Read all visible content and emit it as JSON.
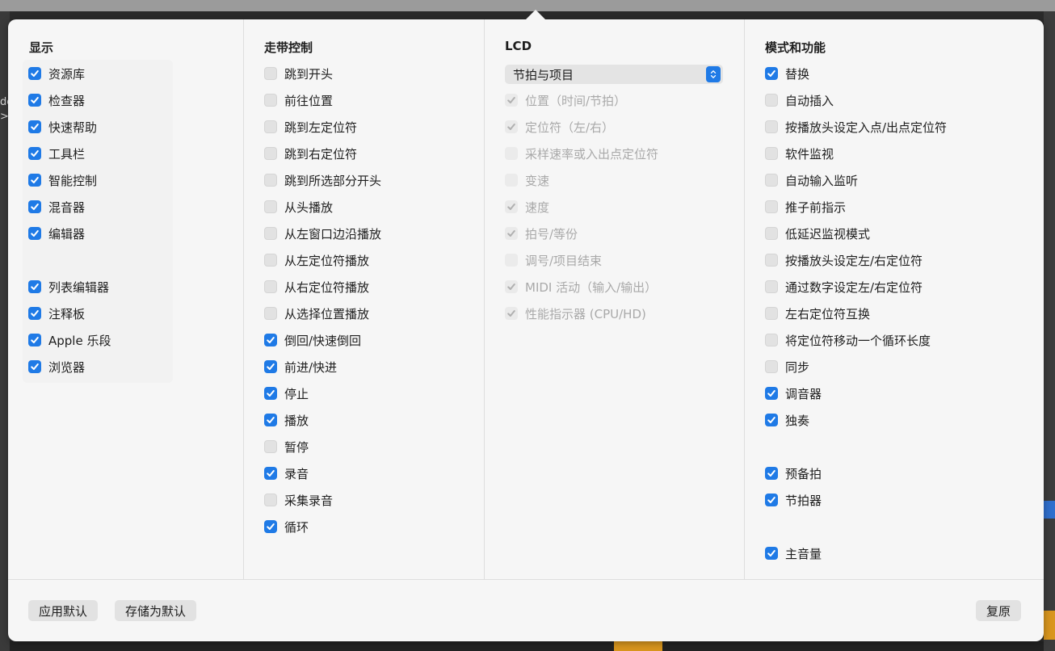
{
  "background": {
    "left_text": "de\n>"
  },
  "sections": {
    "display": {
      "title": "显示",
      "items": [
        {
          "label": "资源库",
          "checked": true
        },
        {
          "label": "检查器",
          "checked": true
        },
        {
          "label": "快速帮助",
          "checked": true
        },
        {
          "label": "工具栏",
          "checked": true
        },
        {
          "label": "智能控制",
          "checked": true
        },
        {
          "label": "混音器",
          "checked": true
        },
        {
          "label": "编辑器",
          "checked": true
        },
        {
          "label": "列表编辑器",
          "checked": true
        },
        {
          "label": "注释板",
          "checked": true
        },
        {
          "label": "Apple 乐段",
          "checked": true
        },
        {
          "label": "浏览器",
          "checked": true
        }
      ]
    },
    "transport": {
      "title": "走带控制",
      "items": [
        {
          "label": "跳到开头",
          "checked": false
        },
        {
          "label": "前往位置",
          "checked": false
        },
        {
          "label": "跳到左定位符",
          "checked": false
        },
        {
          "label": "跳到右定位符",
          "checked": false
        },
        {
          "label": "跳到所选部分开头",
          "checked": false
        },
        {
          "label": "从头播放",
          "checked": false
        },
        {
          "label": "从左窗口边沿播放",
          "checked": false
        },
        {
          "label": "从左定位符播放",
          "checked": false
        },
        {
          "label": "从右定位符播放",
          "checked": false
        },
        {
          "label": "从选择位置播放",
          "checked": false
        },
        {
          "label": "倒回/快速倒回",
          "checked": true
        },
        {
          "label": "前进/快进",
          "checked": true
        },
        {
          "label": "停止",
          "checked": true
        },
        {
          "label": "播放",
          "checked": true
        },
        {
          "label": "暂停",
          "checked": false
        },
        {
          "label": "录音",
          "checked": true
        },
        {
          "label": "采集录音",
          "checked": false
        },
        {
          "label": "循环",
          "checked": true
        }
      ]
    },
    "lcd": {
      "title": "LCD",
      "select_value": "节拍与项目",
      "items": [
        {
          "label": "位置（时间/节拍）",
          "checked": true
        },
        {
          "label": "定位符（左/右）",
          "checked": true
        },
        {
          "label": "采样速率或入出点定位符",
          "checked": false
        },
        {
          "label": "变速",
          "checked": false
        },
        {
          "label": "速度",
          "checked": true
        },
        {
          "label": "拍号/等份",
          "checked": true
        },
        {
          "label": "调号/项目结束",
          "checked": false
        },
        {
          "label": "MIDI 活动（输入/输出）",
          "checked": true
        },
        {
          "label": "性能指示器 (CPU/HD)",
          "checked": true
        }
      ]
    },
    "modes": {
      "title": "模式和功能",
      "items": [
        {
          "label": "替换",
          "checked": true
        },
        {
          "label": "自动插入",
          "checked": false
        },
        {
          "label": "按播放头设定入点/出点定位符",
          "checked": false
        },
        {
          "label": "软件监视",
          "checked": false
        },
        {
          "label": "自动输入监听",
          "checked": false
        },
        {
          "label": "推子前指示",
          "checked": false
        },
        {
          "label": "低延迟监视模式",
          "checked": false
        },
        {
          "label": "按播放头设定左/右定位符",
          "checked": false
        },
        {
          "label": "通过数字设定左/右定位符",
          "checked": false
        },
        {
          "label": "左右定位符互换",
          "checked": false
        },
        {
          "label": "将定位符移动一个循环长度",
          "checked": false
        },
        {
          "label": "同步",
          "checked": false
        },
        {
          "label": "调音器",
          "checked": true
        },
        {
          "label": "独奏",
          "checked": true
        },
        {
          "label": "预备拍",
          "checked": true
        },
        {
          "label": "节拍器",
          "checked": true
        },
        {
          "label": "主音量",
          "checked": true
        }
      ]
    }
  },
  "buttons": {
    "apply_default": "应用默认",
    "save_as_default": "存储为默认",
    "revert": "复原"
  },
  "colors": {
    "accent": "#1f7ae6",
    "popover_bg": "#f6f6f6"
  },
  "icons": {
    "checkmark": "checkmark-icon",
    "select_stepper": "chevron-up-down-icon"
  }
}
